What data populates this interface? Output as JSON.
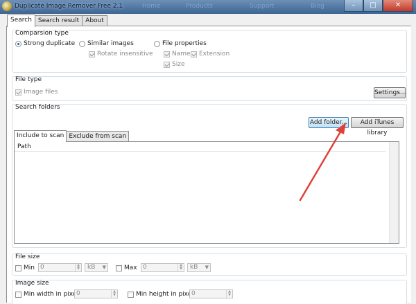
{
  "window": {
    "title": "Duplicate Image Remover Free 2.1",
    "web_nav": [
      "Home",
      "Products",
      "Support",
      "Blog"
    ],
    "minimize_glyph": "–",
    "maximize_glyph": "□",
    "close_glyph": "✕"
  },
  "tabs": [
    {
      "label": "Search",
      "active": true
    },
    {
      "label": "Search result",
      "active": false
    },
    {
      "label": "About",
      "active": false
    }
  ],
  "comparison": {
    "title": "Comparsion type",
    "strong_duplicate": "Strong duplicate",
    "similar_images": "Similar images",
    "rotate_insensitive": "Rotate insensitive",
    "file_properties": "File properties",
    "name": "Name",
    "extension": "Extension",
    "size": "Size"
  },
  "file_type": {
    "title": "File type",
    "image_files": "Image files",
    "settings_button": "Settings..."
  },
  "search_folders": {
    "title": "Search folders",
    "add_folder_button": "Add folder...",
    "add_itunes_button": "Add iTunes library",
    "tabs": [
      "Include to scan",
      "Exclude from scan"
    ],
    "column_path": "Path"
  },
  "file_size": {
    "title": "File size",
    "min_label": "Min",
    "min_value": "0",
    "min_unit": "kB",
    "max_label": "Max",
    "max_value": "0",
    "max_unit": "kB"
  },
  "image_size": {
    "title": "Image size",
    "min_width_label": "Min width in pixel",
    "min_width_value": "0",
    "min_height_label": "Min height in pixel",
    "min_height_value": "0"
  },
  "colors": {
    "annotation_arrow": "#e0403a",
    "focused_button": "#bfe2f6",
    "title_bar": "#4f76a3"
  }
}
